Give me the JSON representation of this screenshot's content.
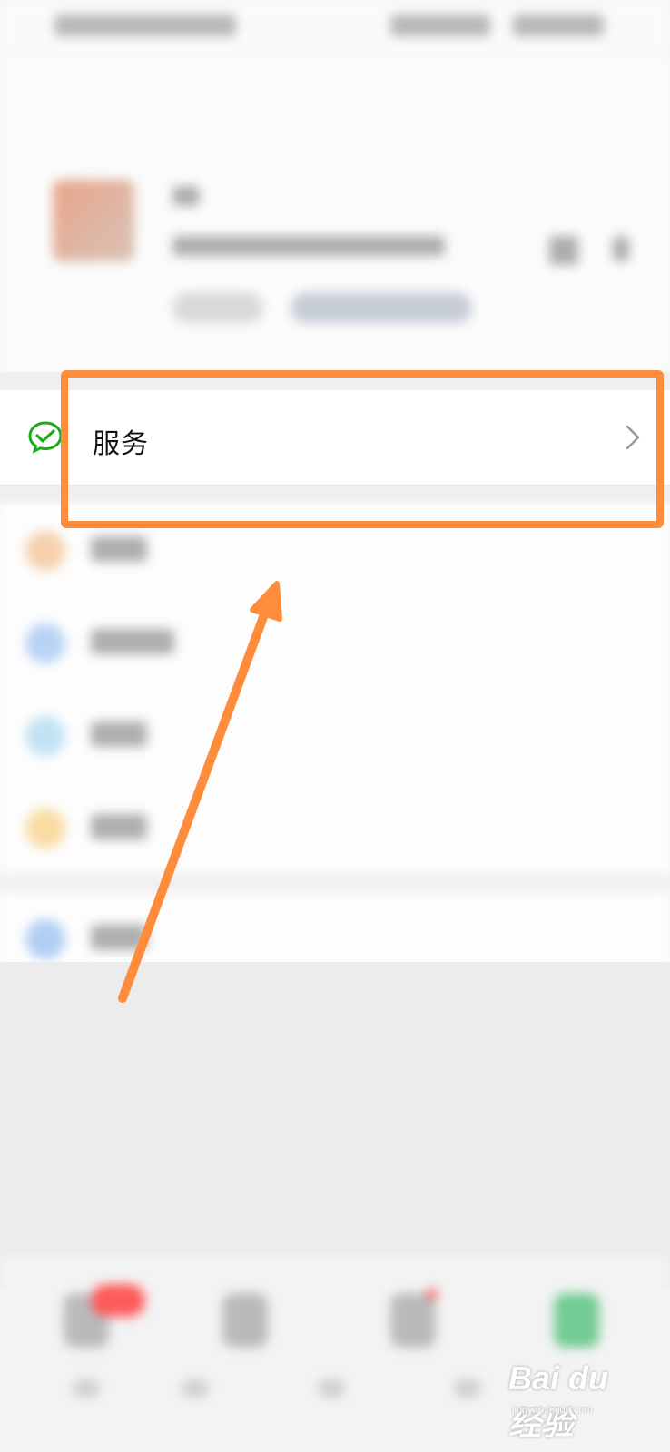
{
  "service": {
    "label": "服务",
    "icon": "wechat-pay-icon",
    "chevron": "chevron-right-icon"
  },
  "highlight": {
    "color": "#ff8c3b"
  },
  "watermark": {
    "brand": "Bai du 经验",
    "sub": "jingyan.baidu.com"
  },
  "colors": {
    "accent": "#ff8c3b",
    "wechat_green": "#1aad19"
  }
}
